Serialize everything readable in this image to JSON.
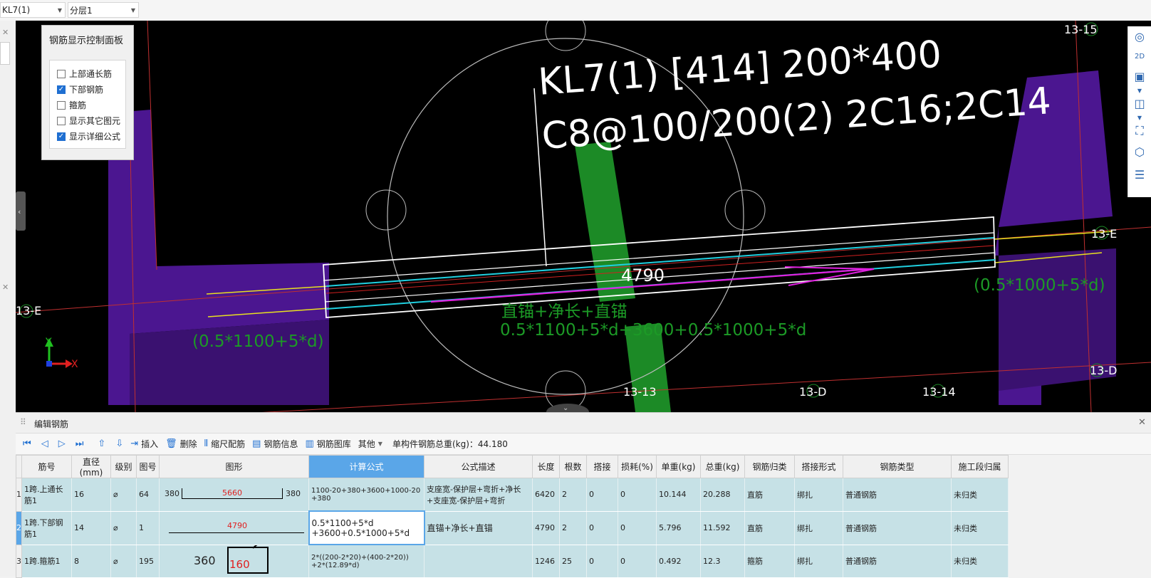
{
  "topbar": {
    "component_select": "KL7(1)",
    "layer_select": "分层1"
  },
  "control_panel": {
    "title": "钢筋显示控制面板",
    "options": [
      {
        "label": "上部通长筋",
        "checked": false
      },
      {
        "label": "下部钢筋",
        "checked": true
      },
      {
        "label": "箍筋",
        "checked": false
      },
      {
        "label": "显示其它图元",
        "checked": false
      },
      {
        "label": "显示详细公式",
        "checked": true
      }
    ]
  },
  "viewport": {
    "beam_label_line1": "KL7(1) [414] 200*400",
    "beam_label_line2": "C8@100/200(2) 2C16;2C14",
    "length_label": "4790",
    "formula_desc": "直锚+净长+直锚",
    "formula_detail": "0.5*1100+5*d+3600+0.5*1000+5*d",
    "left_anchor": "(0.5*1100+5*d)",
    "right_anchor": "(0.5*1000+5*d)",
    "axes": [
      "13-15",
      "13-E",
      "13-E",
      "13-D",
      "13-13",
      "13-D",
      "13-14"
    ],
    "coord_y": "Y",
    "coord_x": "X"
  },
  "edit_panel": {
    "title": "编辑钢筋",
    "toolbar": {
      "insert": "插入",
      "delete": "删除",
      "scale_rebar": "缩尺配筋",
      "rebar_info": "钢筋信息",
      "rebar_library": "钢筋图库",
      "other": "其他",
      "total_weight": "单构件钢筋总重(kg)：44.180"
    },
    "columns": [
      "筋号",
      "直径(mm)",
      "级别",
      "图号",
      "图形",
      "计算公式",
      "公式描述",
      "长度",
      "根数",
      "搭接",
      "损耗(%)",
      "单重(kg)",
      "总重(kg)",
      "钢筋归类",
      "搭接形式",
      "钢筋类型",
      "施工段归属"
    ],
    "rows": [
      {
        "index": "1",
        "name": "1跨.上通长筋1",
        "diameter": "16",
        "grade": "⌀",
        "shape_no": "64",
        "shape_left": "380",
        "shape_mid": "5660",
        "shape_right": "380",
        "formula": "1100-20+380+3600+1000-20+380",
        "desc": "支座宽-保护层+弯折+净长+支座宽-保护层+弯折",
        "length": "6420",
        "count": "2",
        "lap": "0",
        "loss": "0",
        "unit_weight": "10.144",
        "total_weight": "20.288",
        "category": "直筋",
        "lap_type": "绑扎",
        "rebar_type": "普通钢筋",
        "section": "未归类"
      },
      {
        "index": "2",
        "name": "1跨.下部钢筋1",
        "diameter": "14",
        "grade": "⌀",
        "shape_no": "1",
        "shape_mid": "4790",
        "formula_line1": "0.5*1100+5*d",
        "formula_line2": "+3600+0.5*1000+5*d",
        "desc": "直锚+净长+直锚",
        "length": "4790",
        "count": "2",
        "lap": "0",
        "loss": "0",
        "unit_weight": "5.796",
        "total_weight": "11.592",
        "category": "直筋",
        "lap_type": "绑扎",
        "rebar_type": "普通钢筋",
        "section": "未归类"
      },
      {
        "index": "3",
        "name": "1跨.箍筋1",
        "diameter": "8",
        "grade": "⌀",
        "shape_no": "195",
        "shape_left": "360",
        "shape_mid": "160",
        "formula_line1": "2*((200-2*20)+(400-2*20))",
        "formula_line2": "+2*(12.89*d)",
        "desc": "",
        "length": "1246",
        "count": "25",
        "lap": "0",
        "loss": "0",
        "unit_weight": "0.492",
        "total_weight": "12.3",
        "category": "箍筋",
        "lap_type": "绑扎",
        "rebar_type": "普通钢筋",
        "section": "未归类"
      }
    ]
  },
  "colors": {
    "viewport_bg": "#000000",
    "wall": "#4b1690",
    "rebar_green": "#1c8a26",
    "highlight_blue": "#5aa6e8",
    "row_bg": "#c6e1e6"
  }
}
